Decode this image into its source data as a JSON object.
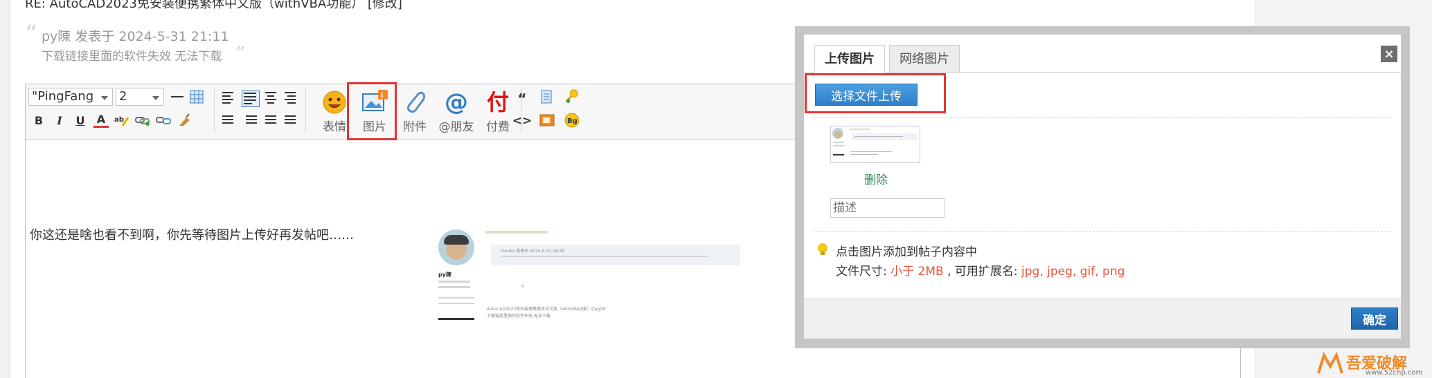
{
  "post": {
    "title": "RE: AutoCAD2023免安装便携繁体中文版（withVBA功能） [修改]",
    "quote_author_line": "py陳 发表于 2024-5-31 21:11",
    "quote_text": "下载链接里面的软件失效 无法下载"
  },
  "editor": {
    "font_family_value": "\"PingFang",
    "font_size_value": "2",
    "buttons": {
      "emoji": "表情",
      "image": "图片",
      "attachment": "附件",
      "mention": "@朋友",
      "pay": "付费"
    },
    "content_text": "你这还是啥也看不到啊，你先等待图片上传好再发帖吧……"
  },
  "embedded_image": {
    "username": "py陳",
    "quote_header": "mouka 发表于 2024-5-31 16:40",
    "link_text": "AutoCAD2023免安装便携繁体中文版（withVBA功能）[tag]3t",
    "sub_text": "下载链接里面的软件失效 无法下载"
  },
  "modal": {
    "tabs": [
      "上传图片",
      "网络图片"
    ],
    "active_tab": 0,
    "close_glyph": "×",
    "upload_button": "选择文件上传",
    "delete_link": "删除",
    "description_placeholder": "描述",
    "tip_line1": "点击图片添加到帖子内容中",
    "tip_size_label": "文件尺寸: ",
    "tip_size_value": "小于 2MB",
    "tip_ext_label": " , 可用扩展名: ",
    "tip_ext_value": "jpg, jpeg, gif, png",
    "ok_button": "确定"
  },
  "watermark": {
    "title": "吾爱破解",
    "url": "www.52cnp.com"
  },
  "colors": {
    "highlight_red": "#e53333",
    "primary_blue": "#2f7fc8",
    "delete_green": "#2e8b57",
    "tip_red": "#e8533c"
  },
  "icons": [
    "bold-icon",
    "italic-icon",
    "underline-icon",
    "font-color-icon",
    "link-icon",
    "unlink-icon",
    "eraser-icon",
    "table-icon",
    "align-left-icon",
    "align-center-icon",
    "align-right-icon",
    "ordered-list-icon",
    "unordered-list-icon",
    "smiley-icon",
    "image-icon",
    "paperclip-icon",
    "at-icon",
    "quote-icon",
    "code-icon",
    "bulb-icon",
    "close-icon"
  ]
}
